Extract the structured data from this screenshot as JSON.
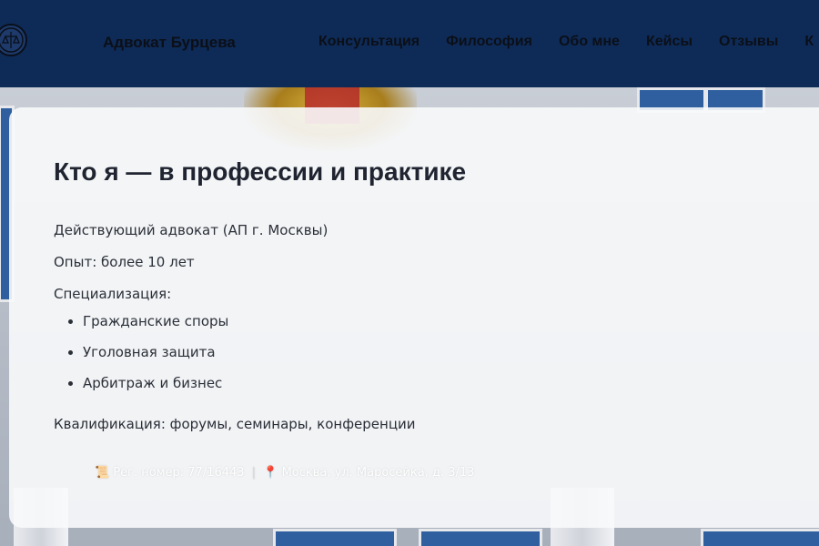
{
  "navbar": {
    "brand": "Адвокат Бурцева",
    "links": [
      "Консультация",
      "Философия",
      "Обо мне",
      "Кейсы",
      "Отзывы",
      "К"
    ]
  },
  "about": {
    "title": "Кто я — в профессии и практике",
    "status": "Действующий адвокат (АП г. Москвы)",
    "experience": "Опыт: более 10 лет",
    "specialization_label": "Специализация:",
    "specializations": [
      "Гражданские споры",
      "Уголовная защита",
      "Арбитраж и бизнес"
    ],
    "qualification": "Квалификация: форумы, семинары, конференции"
  },
  "footer": {
    "registration": "Рег. номер: 77/16443",
    "separator": "|",
    "address": "Москва, ул. Маросейка, д. 3/13",
    "registration_icon": "scroll-icon",
    "address_icon": "pin-icon"
  },
  "colors": {
    "navbar": "#0e2b57",
    "card": "#f8f9fb",
    "text": "#1f2430"
  }
}
